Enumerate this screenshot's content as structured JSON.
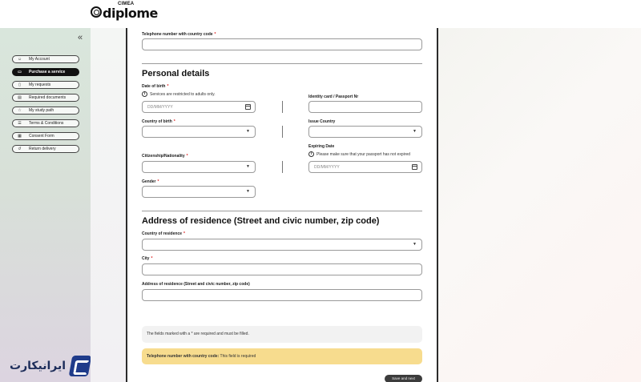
{
  "header": {
    "logo_small": "CIMEA",
    "logo_brand": "diplome"
  },
  "sidebar": {
    "collapse_icon": "chevrons-left-icon",
    "items": [
      {
        "label": "My Account",
        "icon": "user-icon",
        "active": false
      },
      {
        "label": "Purchase a service",
        "icon": "cart-icon",
        "active": true
      },
      {
        "label": "My requests",
        "icon": "document-icon",
        "active": false
      },
      {
        "label": "Required documents",
        "icon": "folder-icon",
        "active": false
      },
      {
        "label": "My study path",
        "icon": "star-icon",
        "active": false
      },
      {
        "label": "Terms & Conditions",
        "icon": "list-icon",
        "active": false
      },
      {
        "label": "Consent Form",
        "icon": "form-icon",
        "active": false
      },
      {
        "label": "Return delivery",
        "icon": "return-icon",
        "active": false
      }
    ]
  },
  "watermark": {
    "text": "ایرانیکارت"
  },
  "form": {
    "telephone": {
      "label": "Telephone number with country code",
      "required": "*",
      "value": ""
    },
    "personal": {
      "title": "Personal details",
      "dob": {
        "label": "Date of birth",
        "required": "*",
        "note": "Services are restricted to adults only.",
        "placeholder": "DD/MM/YYYY"
      },
      "identity": {
        "label": "Identity card / Passport Nr",
        "value": ""
      },
      "country_of_birth": {
        "label": "Country of birth",
        "required": "*",
        "value": ""
      },
      "issue_country": {
        "label": "Issue Country",
        "value": ""
      },
      "expiring": {
        "label": "Expiring Date",
        "note": "Please make sure that your passport has not expired",
        "placeholder": "DD/MM/YYYY"
      },
      "citizenship": {
        "label": "Citizenship/Nationality",
        "required": "*",
        "value": ""
      },
      "gender": {
        "label": "Gender",
        "required": "*",
        "value": ""
      }
    },
    "address": {
      "title": "Address of residence (Street and civic number, zip code)",
      "country": {
        "label": "Country of residence",
        "required": "*",
        "value": ""
      },
      "city": {
        "label": "City",
        "required": "*",
        "value": ""
      },
      "street": {
        "label": "Address of residence (Street and civic number, zip code)",
        "value": ""
      }
    },
    "info_text": "The fields marked with a * are required and must be filled.",
    "error": {
      "field": "Telephone number with country code:",
      "message": "This field is required"
    },
    "save_label": "Save and next"
  }
}
